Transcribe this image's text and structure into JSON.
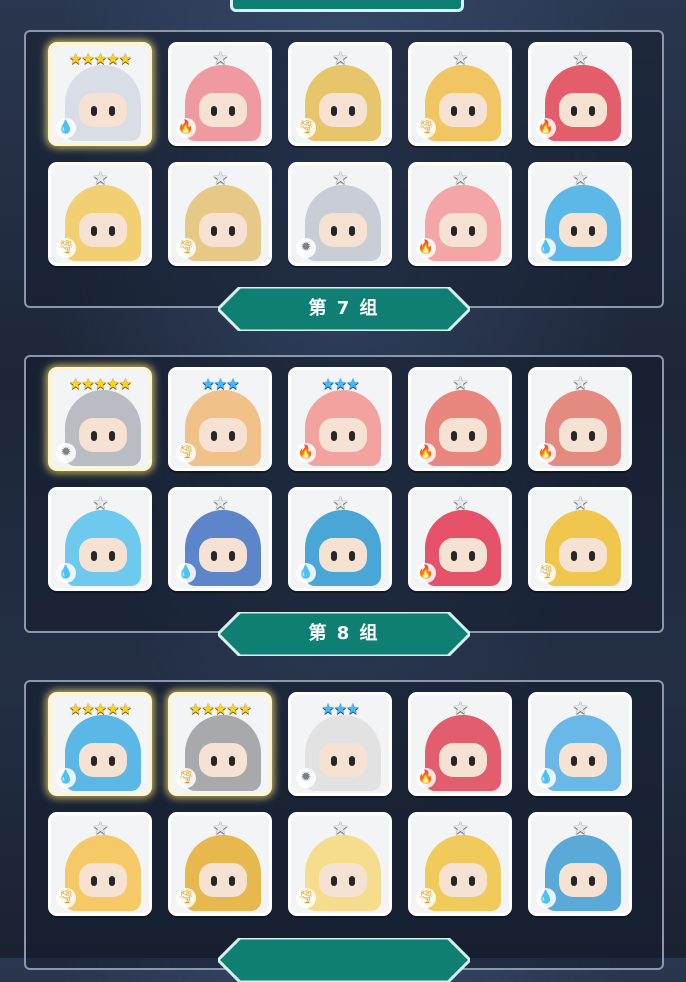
{
  "groups": [
    {
      "label": "",
      "cards": [
        {
          "stars": "★★★★★",
          "star_type": "gold",
          "element": "water",
          "glow": true,
          "color": "#d9dde6"
        },
        {
          "stars": "★",
          "star_type": "silver",
          "element": "fire",
          "glow": false,
          "color": "#ef9aa0"
        },
        {
          "stars": "★",
          "star_type": "silver",
          "element": "wind",
          "glow": false,
          "color": "#e7c56a"
        },
        {
          "stars": "★",
          "star_type": "silver",
          "element": "wind",
          "glow": false,
          "color": "#f1c561"
        },
        {
          "stars": "★",
          "star_type": "silver",
          "element": "fire",
          "glow": false,
          "color": "#e35d6a"
        },
        {
          "stars": "★",
          "star_type": "silver",
          "element": "wind",
          "glow": false,
          "color": "#f1cf72"
        },
        {
          "stars": "★",
          "star_type": "silver",
          "element": "wind",
          "glow": false,
          "color": "#e6c987"
        },
        {
          "stars": "★",
          "star_type": "silver",
          "element": "light",
          "glow": false,
          "color": "#c9ced6"
        },
        {
          "stars": "★",
          "star_type": "silver",
          "element": "fire",
          "glow": false,
          "color": "#f4a6a6"
        },
        {
          "stars": "★",
          "star_type": "silver",
          "element": "water",
          "glow": false,
          "color": "#5db8e8"
        }
      ]
    },
    {
      "label": "第 7 组",
      "cards": [
        {
          "stars": "★★★★★",
          "star_type": "gold",
          "element": "light",
          "glow": true,
          "color": "#b9bcc3"
        },
        {
          "stars": "★★★",
          "star_type": "blue",
          "element": "wind",
          "glow": false,
          "color": "#f0c28a"
        },
        {
          "stars": "★★★",
          "star_type": "blue",
          "element": "fire",
          "glow": false,
          "color": "#f2a3a0"
        },
        {
          "stars": "★",
          "star_type": "silver",
          "element": "fire",
          "glow": false,
          "color": "#e9867e"
        },
        {
          "stars": "★",
          "star_type": "silver",
          "element": "fire",
          "glow": false,
          "color": "#e58a80"
        },
        {
          "stars": "★",
          "star_type": "silver",
          "element": "water",
          "glow": false,
          "color": "#6ec9ef"
        },
        {
          "stars": "★",
          "star_type": "silver",
          "element": "water",
          "glow": false,
          "color": "#5c86c9"
        },
        {
          "stars": "★",
          "star_type": "silver",
          "element": "water",
          "glow": false,
          "color": "#4aa6d6"
        },
        {
          "stars": "★",
          "star_type": "silver",
          "element": "fire",
          "glow": false,
          "color": "#e5526a"
        },
        {
          "stars": "★",
          "star_type": "silver",
          "element": "wind",
          "glow": false,
          "color": "#f0c64e"
        }
      ]
    },
    {
      "label": "第 8 组",
      "cards": [
        {
          "stars": "★★★★★",
          "star_type": "gold",
          "element": "water",
          "glow": true,
          "color": "#5ab7e6"
        },
        {
          "stars": "★★★★★",
          "star_type": "gold",
          "element": "wind",
          "glow": true,
          "color": "#a8a9ad"
        },
        {
          "stars": "★★★",
          "star_type": "blue",
          "element": "light",
          "glow": false,
          "color": "#e2e2e2"
        },
        {
          "stars": "★",
          "star_type": "silver",
          "element": "fire",
          "glow": false,
          "color": "#e25d6e"
        },
        {
          "stars": "★",
          "star_type": "silver",
          "element": "water",
          "glow": false,
          "color": "#6ab8e8"
        },
        {
          "stars": "★",
          "star_type": "silver",
          "element": "wind",
          "glow": false,
          "color": "#f5c965"
        },
        {
          "stars": "★",
          "star_type": "silver",
          "element": "wind",
          "glow": false,
          "color": "#e7b84e"
        },
        {
          "stars": "★",
          "star_type": "silver",
          "element": "wind",
          "glow": false,
          "color": "#f6dc8d"
        },
        {
          "stars": "★",
          "star_type": "silver",
          "element": "wind",
          "glow": false,
          "color": "#f0cb5b"
        },
        {
          "stars": "★",
          "star_type": "silver",
          "element": "water",
          "glow": false,
          "color": "#5aa9d8"
        }
      ]
    }
  ],
  "element_icons": {
    "water": "water-drop-icon",
    "fire": "fire-icon",
    "wind": "wind-icon",
    "light": "sun-icon"
  },
  "colors": {
    "ribbon": "#0f7f73",
    "ribbon_border": "#d7f2ec",
    "panel_border": "#8a97ad",
    "gold_star": "#ffd21e",
    "blue_star": "#45b8ff"
  }
}
